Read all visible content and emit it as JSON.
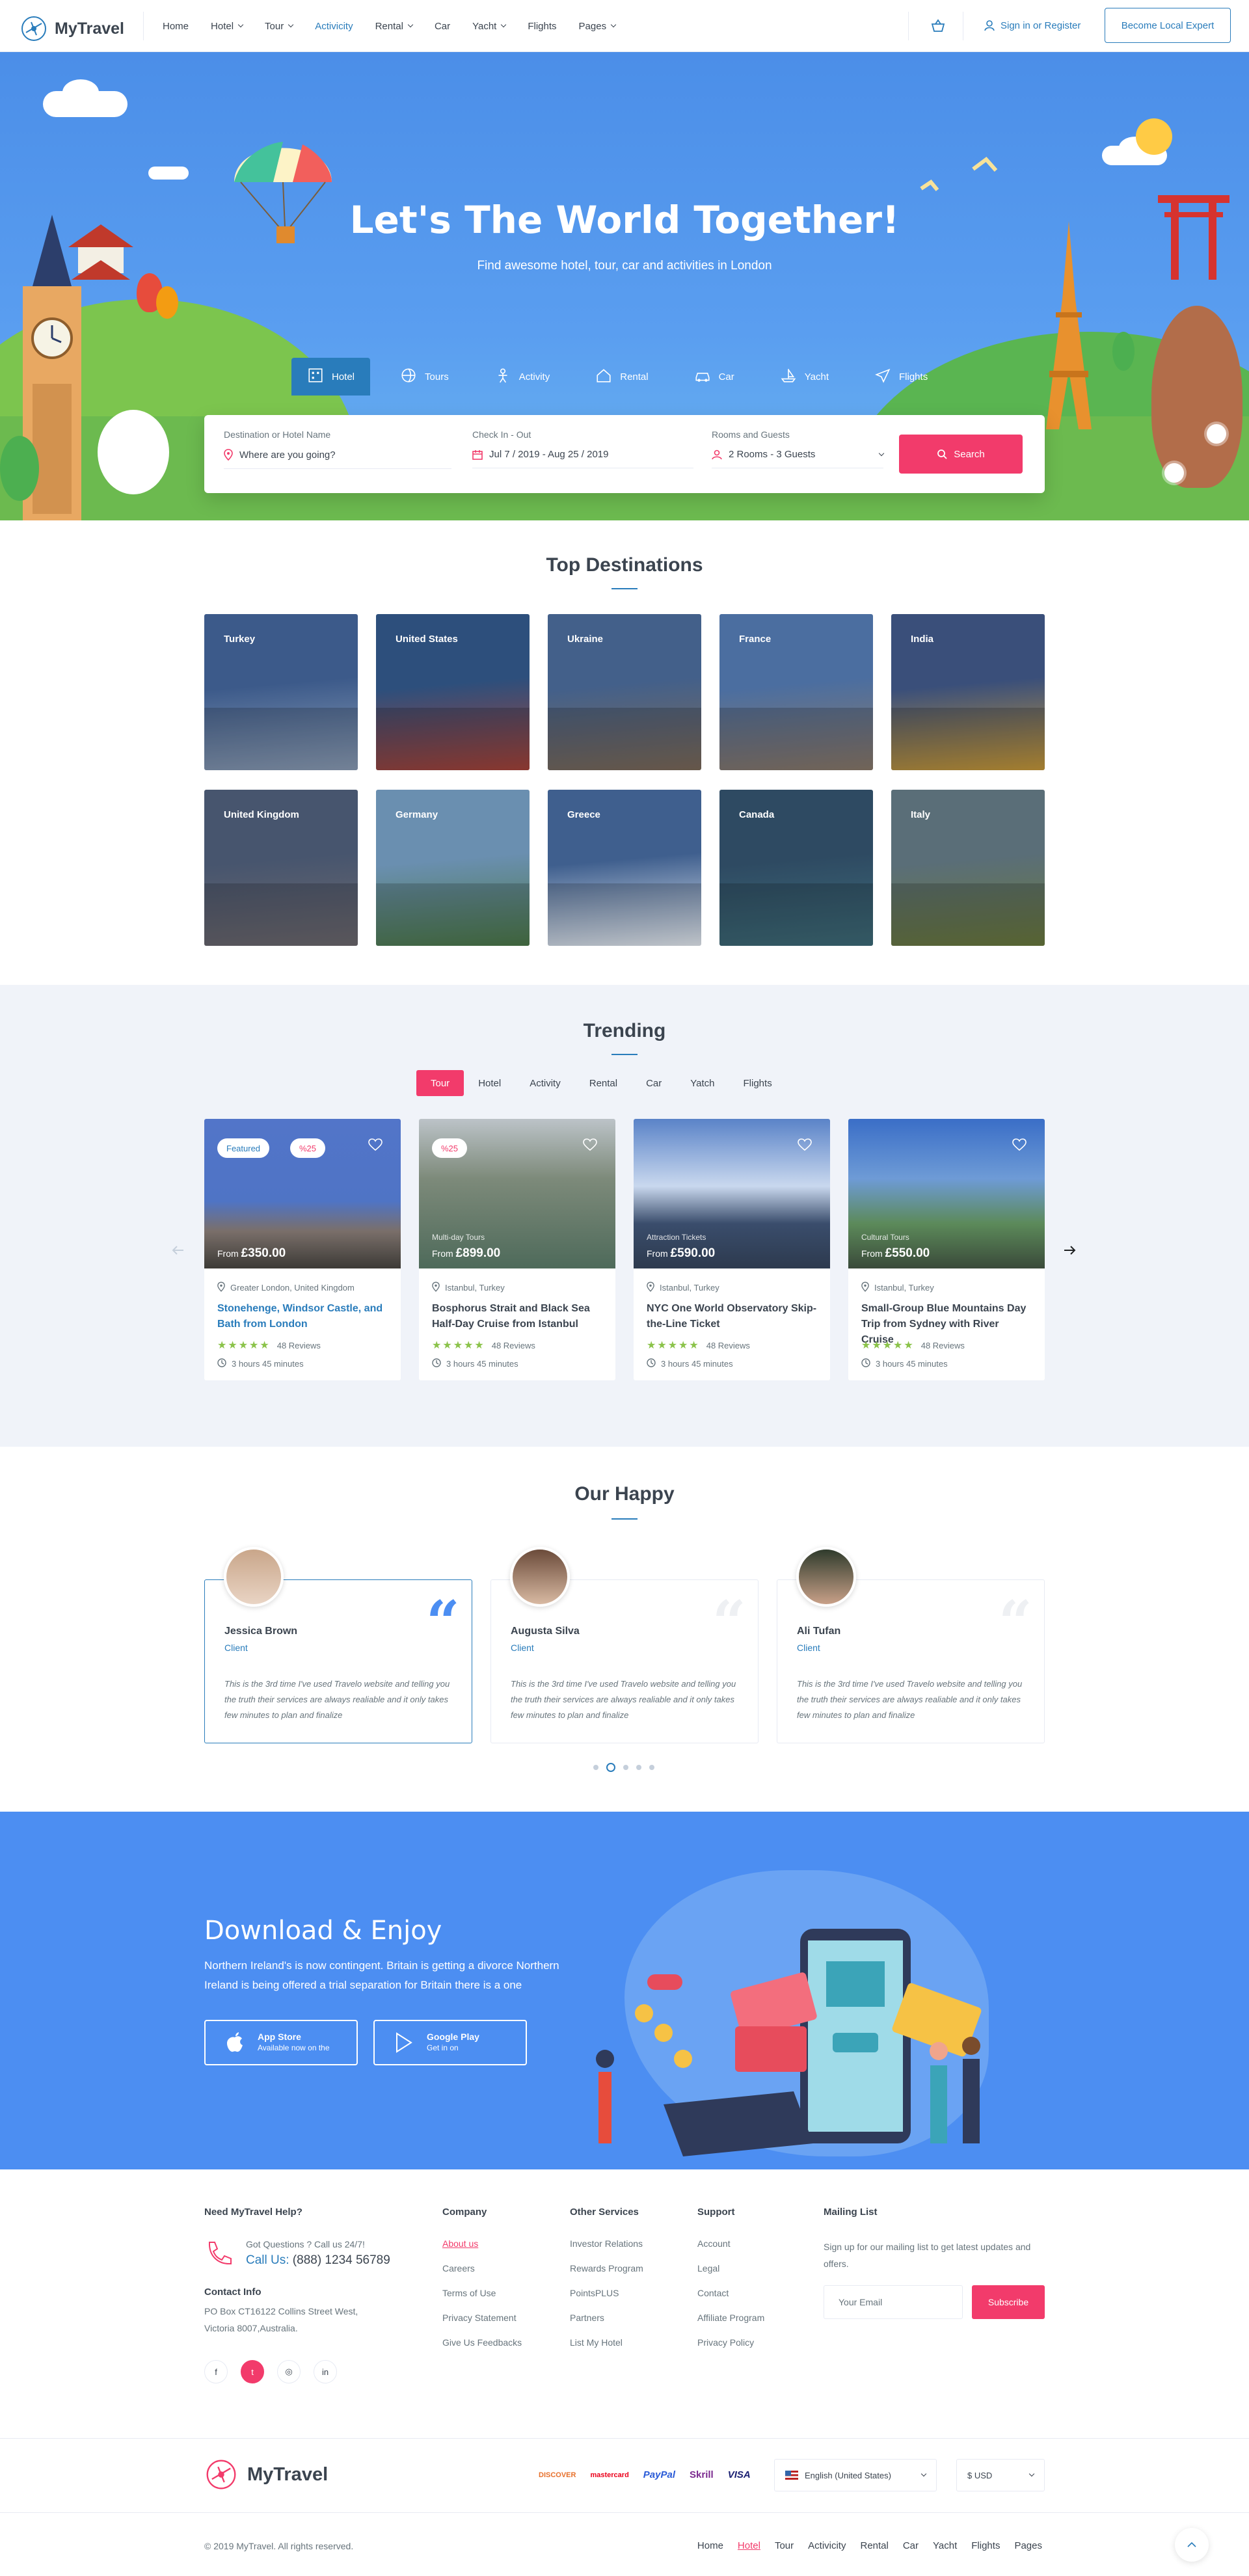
{
  "header": {
    "logo": "MyTravel",
    "nav": [
      {
        "label": "Home",
        "caret": false
      },
      {
        "label": "Hotel",
        "caret": true
      },
      {
        "label": "Tour",
        "caret": true
      },
      {
        "label": "Activicity",
        "caret": false,
        "active": true
      },
      {
        "label": "Rental",
        "caret": true
      },
      {
        "label": "Car",
        "caret": false
      },
      {
        "label": "Yacht",
        "caret": true
      },
      {
        "label": "Flights",
        "caret": false
      },
      {
        "label": "Pages",
        "caret": true
      }
    ],
    "signin": "Sign in or Register",
    "cta": "Become Local Expert"
  },
  "hero": {
    "title": "Let's The World Together!",
    "subtitle": "Find awesome hotel, tour, car and activities in London",
    "tabs": [
      "Hotel",
      "Tours",
      "Activity",
      "Rental",
      "Car",
      "Yacht",
      "Flights"
    ],
    "search": {
      "destination_label": "Destination or Hotel Name",
      "destination_value": "Where are you going?",
      "dates_label": "Check In - Out",
      "dates_value": "Jul 7 / 2019 - Aug 25 / 2019",
      "guests_label": "Rooms and Guests",
      "guests_value": "2 Rooms - 3 Guests",
      "button": "Search"
    }
  },
  "destinations": {
    "title": "Top Destinations",
    "items": [
      "Turkey",
      "United States",
      "Ukraine",
      "France",
      "India",
      "United Kingdom",
      "Germany",
      "Greece",
      "Canada",
      "Italy"
    ]
  },
  "trending": {
    "title": "Trending",
    "tabs": [
      "Tour",
      "Hotel",
      "Activity",
      "Rental",
      "Car",
      "Yatch",
      "Flights"
    ],
    "cards": [
      {
        "badge1": "Featured",
        "badge2": "%25",
        "type": "",
        "from": "From",
        "price": "£350.00",
        "location": "Greater London, United Kingdom",
        "title": "Stonehenge, Windsor Castle, and Bath from London",
        "reviews": "48 Reviews",
        "duration": "3 hours 45 minutes"
      },
      {
        "badge1": "",
        "badge2": "%25",
        "type": "Multi-day Tours",
        "from": "From",
        "price": "£899.00",
        "location": "Istanbul, Turkey",
        "title": "Bosphorus Strait and Black Sea Half-Day Cruise from Istanbul",
        "reviews": "48 Reviews",
        "duration": "3 hours 45 minutes"
      },
      {
        "badge1": "",
        "badge2": "",
        "type": "Attraction Tickets",
        "from": "From",
        "price": "£590.00",
        "location": "Istanbul, Turkey",
        "title": "NYC One World Observatory Skip-the-Line Ticket",
        "reviews": "48 Reviews",
        "duration": "3 hours 45 minutes"
      },
      {
        "badge1": "",
        "badge2": "",
        "type": "Cultural Tours",
        "from": "From",
        "price": "£550.00",
        "location": "Istanbul, Turkey",
        "title": "Small-Group Blue Mountains Day Trip from Sydney with River Cruise",
        "reviews": "48 Reviews",
        "duration": "3 hours 45 minutes"
      }
    ]
  },
  "testimonials": {
    "title": "Our Happy",
    "items": [
      {
        "name": "Jessica Brown",
        "role": "Client",
        "text": "This is the 3rd time I've used Travelo website and telling you the truth their services are always realiable and it only takes few minutes to plan and finalize"
      },
      {
        "name": "Augusta Silva",
        "role": "Client",
        "text": "This is the 3rd time I've used Travelo website and telling you the truth their services are always realiable and it only takes few minutes to plan and finalize"
      },
      {
        "name": "Ali Tufan",
        "role": "Client",
        "text": "This is the 3rd time I've used Travelo website and telling you the truth their services are always realiable and it only takes few minutes to plan and finalize"
      }
    ]
  },
  "download": {
    "title": "Download & Enjoy",
    "text": "Northern Ireland's is now contingent. Britain is getting a divorce Northern Ireland is being offered a trial separation for Britain there is a one",
    "appstore_title": "App Store",
    "appstore_sub": "Available now on the",
    "gplay_title": "Google Play",
    "gplay_sub": "Get in on"
  },
  "footer": {
    "help_title": "Need MyTravel Help?",
    "questions": "Got Questions ? Call us 24/7!",
    "call_label": "Call Us:",
    "phone": "(888) 1234 56789",
    "contact_title": "Contact Info",
    "address": "PO Box CT16122 Collins Street West, Victoria 8007,Australia.",
    "company_title": "Company",
    "company_links": [
      "About us",
      "Careers",
      "Terms of Use",
      "Privacy Statement",
      "Give Us Feedbacks"
    ],
    "services_title": "Other Services",
    "services_links": [
      "Investor Relations",
      "Rewards Program",
      "PointsPLUS",
      "Partners",
      "List My Hotel"
    ],
    "support_title": "Support",
    "support_links": [
      "Account",
      "Legal",
      "Contact",
      "Affiliate Program",
      "Privacy Policy"
    ],
    "mailing_title": "Mailing List",
    "mailing_text": "Sign up for our mailing list to get latest updates and offers.",
    "email_placeholder": "Your Email",
    "subscribe": "Subscribe",
    "social": [
      "f",
      "t",
      "◎",
      "in"
    ],
    "logo": "MyTravel",
    "payments": [
      "DISCOVER",
      "mastercard",
      "PayPal",
      "Skrill",
      "VISA"
    ],
    "language": "English (United States)",
    "currency": "$ USD",
    "copyright": "© 2019 MyTravel. All rights reserved.",
    "bottom_nav": [
      "Home",
      "Hotel",
      "Tour",
      "Activicity",
      "Rental",
      "Car",
      "Yacht",
      "Flights",
      "Pages"
    ]
  }
}
